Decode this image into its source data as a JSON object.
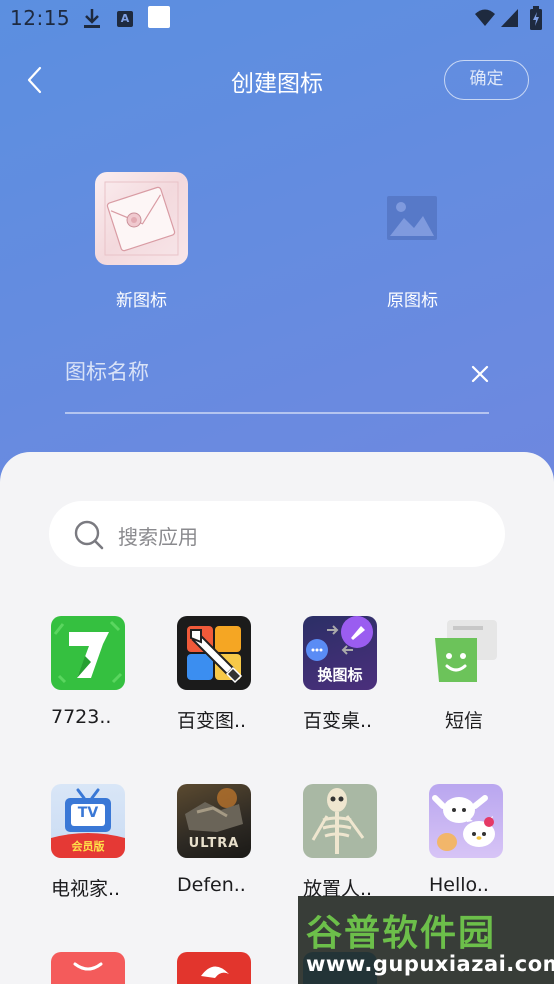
{
  "status_bar": {
    "time": "12:15",
    "a_badge": "A"
  },
  "header": {
    "title": "创建图标",
    "confirm_label": "确定"
  },
  "preview": {
    "new_icon_label": "新图标",
    "original_icon_label": "原图标"
  },
  "name_field": {
    "placeholder": "图标名称"
  },
  "search": {
    "placeholder": "搜索应用"
  },
  "apps": [
    {
      "label": "7723..",
      "icon": "7723-app-icon",
      "icon_text": ""
    },
    {
      "label": "百变图..",
      "icon": "paint-brush-app-icon",
      "icon_text": ""
    },
    {
      "label": "百变桌..",
      "icon": "rocket-swap-app-icon",
      "icon_text": "换图标"
    },
    {
      "label": "短信",
      "icon": "sms-app-icon",
      "icon_text": ""
    },
    {
      "label": "电视家..",
      "icon": "tv-app-icon",
      "icon_text": "TV"
    },
    {
      "label": "Defen..",
      "icon": "defense-game-app-icon",
      "icon_text": "ULTRA"
    },
    {
      "label": "放置人..",
      "icon": "skeleton-app-icon",
      "icon_text": ""
    },
    {
      "label": "Hello..",
      "icon": "hello-kitty-app-icon",
      "icon_text": ""
    },
    {
      "label": "",
      "icon": "shopping-app-icon",
      "icon_text": ""
    },
    {
      "label": "",
      "icon": "red-swirl-app-icon",
      "icon_text": ""
    }
  ],
  "tv_badge": "会员版",
  "watermark": {
    "title": "谷普软件园",
    "url": "www.gupuxiazai.com"
  },
  "colors": {
    "gradient_start": "#5b8fe0",
    "gradient_end": "#7a80dc",
    "sheet_bg": "#f4f4f6",
    "green": "#35c040"
  }
}
